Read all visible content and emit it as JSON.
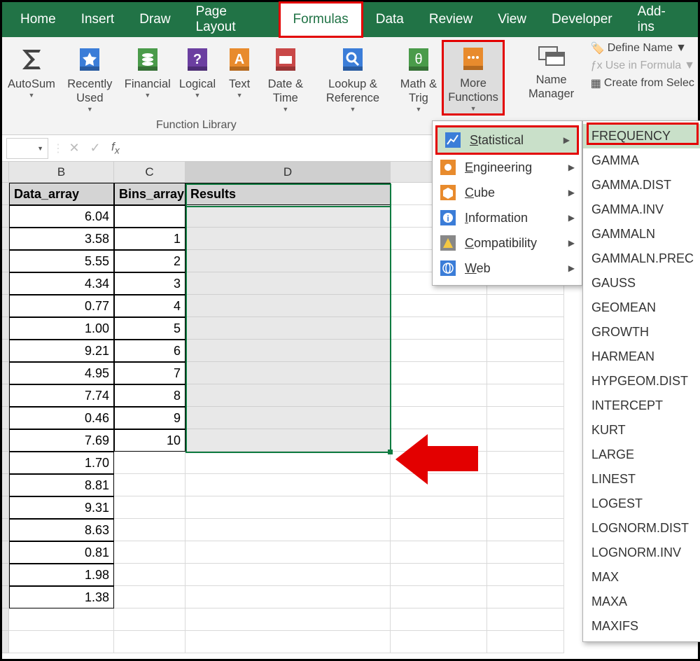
{
  "tabs": [
    "Home",
    "Insert",
    "Draw",
    "Page Layout",
    "Formulas",
    "Data",
    "Review",
    "View",
    "Developer",
    "Add-ins"
  ],
  "active_tab": "Formulas",
  "ribbon": {
    "autosum": "AutoSum",
    "recently": "Recently Used",
    "financial": "Financial",
    "logical": "Logical",
    "text": "Text",
    "datetime": "Date & Time",
    "lookup": "Lookup & Reference",
    "math": "Math & Trig",
    "more": "More Functions",
    "group_label": "Function Library",
    "name_manager": "Name Manager",
    "define_name": "Define Name",
    "use_in_formula": "Use in Formula",
    "create_from": "Create from Selec"
  },
  "more_menu": [
    {
      "label": "Statistical",
      "hot": "S"
    },
    {
      "label": "Engineering",
      "hot": "E"
    },
    {
      "label": "Cube",
      "hot": "C"
    },
    {
      "label": "Information",
      "hot": "I"
    },
    {
      "label": "Compatibility",
      "hot": "C"
    },
    {
      "label": "Web",
      "hot": "W"
    }
  ],
  "stat_functions": [
    "FREQUENCY",
    "GAMMA",
    "GAMMA.DIST",
    "GAMMA.INV",
    "GAMMALN",
    "GAMMALN.PREC",
    "GAUSS",
    "GEOMEAN",
    "GROWTH",
    "HARMEAN",
    "HYPGEOM.DIST",
    "INTERCEPT",
    "KURT",
    "LARGE",
    "LINEST",
    "LOGEST",
    "LOGNORM.DIST",
    "LOGNORM.INV",
    "MAX",
    "MAXA",
    "MAXIFS"
  ],
  "columns": [
    "B",
    "C",
    "D"
  ],
  "headers": {
    "b": "Data_array",
    "c": "Bins_array",
    "d": "Results"
  },
  "data_array": [
    "6.04",
    "3.58",
    "5.55",
    "4.34",
    "0.77",
    "1.00",
    "9.21",
    "4.95",
    "7.74",
    "0.46",
    "7.69",
    "1.70",
    "8.81",
    "9.31",
    "8.63",
    "0.81",
    "1.98",
    "1.38"
  ],
  "bins_array": [
    "",
    "1",
    "2",
    "3",
    "4",
    "5",
    "6",
    "7",
    "8",
    "9",
    "10"
  ],
  "formula_bar": {
    "value": ""
  }
}
